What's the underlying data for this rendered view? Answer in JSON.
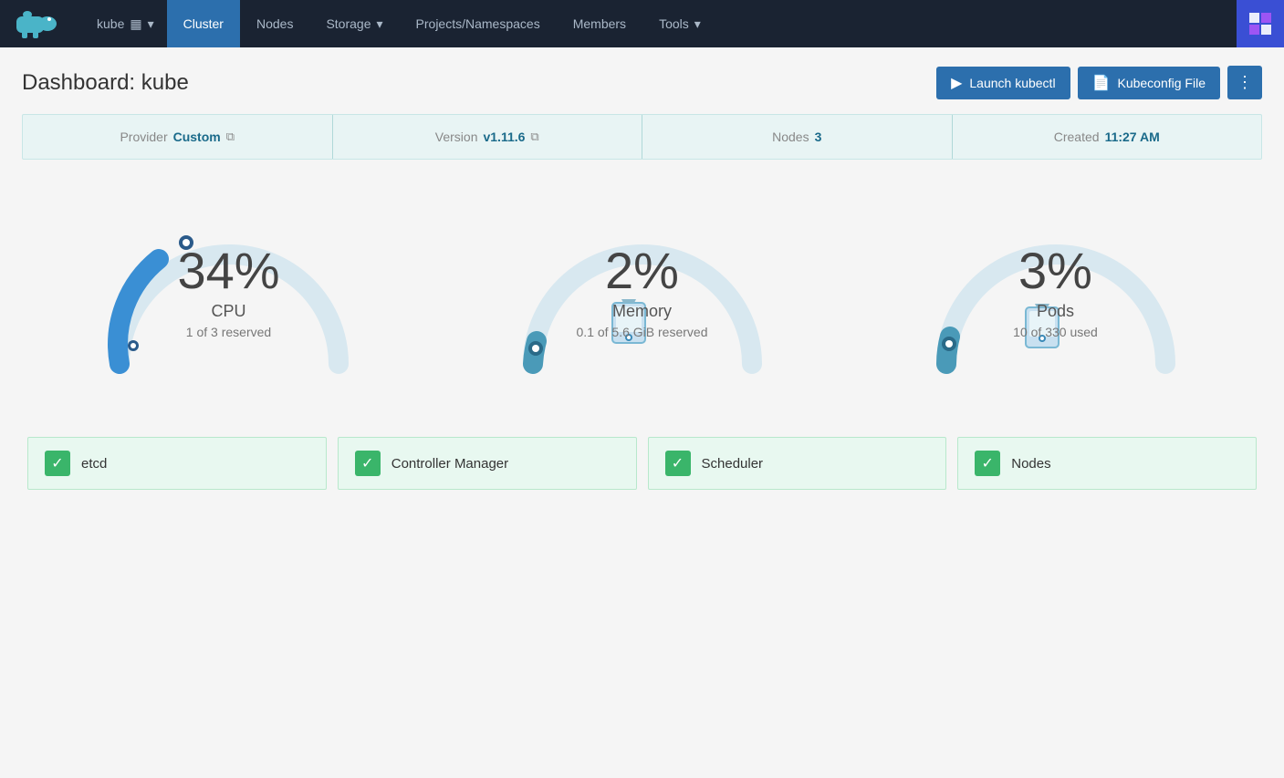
{
  "navbar": {
    "logo": "🦛",
    "cluster_name": "kube",
    "cluster_icon": "▦",
    "nav_items": [
      {
        "label": "Cluster",
        "active": true
      },
      {
        "label": "Nodes",
        "active": false
      },
      {
        "label": "Storage",
        "active": false,
        "dropdown": true
      },
      {
        "label": "Projects/Namespaces",
        "active": false
      },
      {
        "label": "Members",
        "active": false
      },
      {
        "label": "Tools",
        "active": false,
        "dropdown": true
      }
    ]
  },
  "header": {
    "title_prefix": "Dashboard:",
    "title_name": "kube",
    "btn_kubectl": "Launch kubectl",
    "btn_kubeconfig": "Kubeconfig File",
    "btn_dots": "⋮"
  },
  "info_bar": {
    "provider_label": "Provider",
    "provider_value": "Custom",
    "version_label": "Version",
    "version_value": "v1.11.6",
    "nodes_label": "Nodes",
    "nodes_value": "3",
    "created_label": "Created",
    "created_value": "11:27 AM"
  },
  "gauges": [
    {
      "percent": "34%",
      "label": "CPU",
      "sublabel": "1 of 3 reserved",
      "value": 34,
      "color": "#3a8fd4",
      "track_color": "#d8e8f0"
    },
    {
      "percent": "2%",
      "label": "Memory",
      "sublabel": "0.1 of 5.6 GiB reserved",
      "value": 2,
      "color": "#4a9ab8",
      "track_color": "#d8e8f0"
    },
    {
      "percent": "3%",
      "label": "Pods",
      "sublabel": "10 of 330 used",
      "value": 3,
      "color": "#4a9ab8",
      "track_color": "#d8e8f0"
    }
  ],
  "status_cards": [
    {
      "label": "etcd"
    },
    {
      "label": "Controller Manager"
    },
    {
      "label": "Scheduler"
    },
    {
      "label": "Nodes"
    }
  ]
}
